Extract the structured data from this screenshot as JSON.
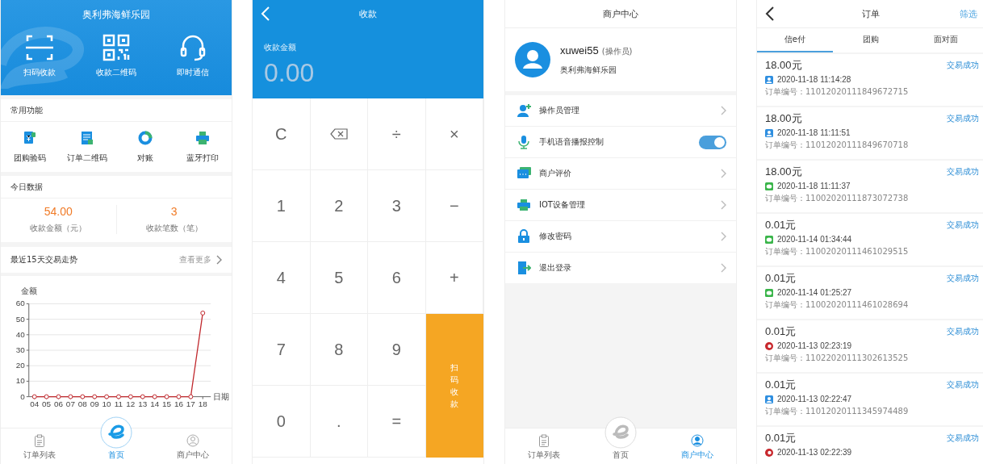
{
  "home": {
    "title": "奥利弗海鲜乐园",
    "quick_actions": [
      {
        "label": "扫码收款"
      },
      {
        "label": "收款二维码"
      },
      {
        "label": "即时通信"
      }
    ],
    "functions": {
      "title": "常用功能",
      "items": [
        {
          "label": "团购验码"
        },
        {
          "label": "订单二维码"
        },
        {
          "label": "对账"
        },
        {
          "label": "蓝牙打印"
        }
      ]
    },
    "today": {
      "title": "今日数据",
      "stats": [
        {
          "value": "54.00",
          "label": "收款金额（元）"
        },
        {
          "value": "3",
          "label": "收款笔数（笔）"
        }
      ]
    },
    "trend": {
      "title": "最近15天交易走势",
      "more": "查看更多",
      "chart_data": {
        "type": "line",
        "xlabel": "日期",
        "ylabel": "金额",
        "categories": [
          "04",
          "05",
          "06",
          "07",
          "08",
          "09",
          "10",
          "11",
          "12",
          "13",
          "14",
          "15",
          "16",
          "17",
          "18"
        ],
        "series": [
          {
            "color": "#c0282d",
            "marker": "circle",
            "values": [
              0,
              0,
              0,
              0,
              0,
              0,
              0,
              0,
              0,
              0,
              0,
              0,
              0,
              0,
              54
            ]
          }
        ],
        "ylim": [
          0,
          60
        ],
        "yticks": [
          0,
          10,
          20,
          30,
          40,
          50,
          60
        ],
        "grid": true
      }
    },
    "tab_bar": [
      {
        "label": "订单列表",
        "selected": false
      },
      {
        "label": "首页",
        "selected": true
      },
      {
        "label": "商户中心",
        "selected": false
      }
    ]
  },
  "payment": {
    "title": "收款",
    "amount_label": "收款金额",
    "amount": "0.00",
    "keys": [
      {
        "label": "C",
        "kind": "key"
      },
      {
        "kind": "backspace"
      },
      {
        "label": "÷",
        "kind": "key"
      },
      {
        "label": "×",
        "kind": "key"
      },
      {
        "label": "1",
        "kind": "key"
      },
      {
        "label": "2",
        "kind": "key"
      },
      {
        "label": "3",
        "kind": "key"
      },
      {
        "label": "−",
        "kind": "key"
      },
      {
        "label": "4",
        "kind": "key"
      },
      {
        "label": "5",
        "kind": "key"
      },
      {
        "label": "6",
        "kind": "key"
      },
      {
        "label": "+",
        "kind": "key"
      },
      {
        "label": "7",
        "kind": "key"
      },
      {
        "label": "8",
        "kind": "key"
      },
      {
        "label": "9",
        "kind": "key"
      },
      {
        "label": "扫码收款",
        "kind": "action"
      },
      {
        "label": "0",
        "kind": "key"
      },
      {
        "label": ".",
        "kind": "key"
      },
      {
        "label": "=",
        "kind": "key"
      }
    ]
  },
  "merchant": {
    "title": "商户中心",
    "user": {
      "name": "xuwei55",
      "role": "(操作员)",
      "store": "奥利弗海鲜乐园"
    },
    "menu": [
      {
        "label": "操作员管理",
        "kind": "link"
      },
      {
        "label": "手机语音播报控制",
        "kind": "toggle",
        "on": true
      },
      {
        "label": "商户评价",
        "kind": "link"
      },
      {
        "label": "IOT设备管理",
        "kind": "link"
      },
      {
        "label": "修改密码",
        "kind": "link"
      },
      {
        "label": "退出登录",
        "kind": "link"
      }
    ],
    "tab_bar": [
      {
        "label": "订单列表",
        "selected": false
      },
      {
        "label": "首页",
        "selected": false
      },
      {
        "label": "商户中心",
        "selected": true
      }
    ]
  },
  "orders": {
    "title": "订单",
    "filter": "筛选",
    "tabs": [
      {
        "label": "信e付",
        "selected": true
      },
      {
        "label": "团购",
        "selected": false
      },
      {
        "label": "面对面",
        "selected": false
      }
    ],
    "items": [
      {
        "amount": "18.00元",
        "status": "交易成功",
        "kind": "person",
        "time": "2020-11-18 11:14:28",
        "order_no": "订单编号：11012020111849672715"
      },
      {
        "amount": "18.00元",
        "status": "交易成功",
        "kind": "person",
        "time": "2020-11-18 11:11:51",
        "order_no": "订单编号：11012020111849670718"
      },
      {
        "amount": "18.00元",
        "status": "交易成功",
        "kind": "chat",
        "time": "2020-11-18 11:11:37",
        "order_no": "订单编号：11002020111873072738"
      },
      {
        "amount": "0.01元",
        "status": "交易成功",
        "kind": "chat",
        "time": "2020-11-14 01:34:44",
        "order_no": "订单编号：11002020111461029515"
      },
      {
        "amount": "0.01元",
        "status": "交易成功",
        "kind": "chat",
        "time": "2020-11-14 01:25:27",
        "order_no": "订单编号：11002020111461028694"
      },
      {
        "amount": "0.01元",
        "status": "交易成功",
        "kind": "ring",
        "time": "2020-11-13 02:23:19",
        "order_no": "订单编号：11022020111302613525"
      },
      {
        "amount": "0.01元",
        "status": "交易成功",
        "kind": "person",
        "time": "2020-11-13 02:22:47",
        "order_no": "订单编号：11012020111345974489"
      },
      {
        "amount": "0.01元",
        "status": "交易成功",
        "kind": "ring",
        "time": "2020-11-13 02:22:39"
      }
    ]
  }
}
